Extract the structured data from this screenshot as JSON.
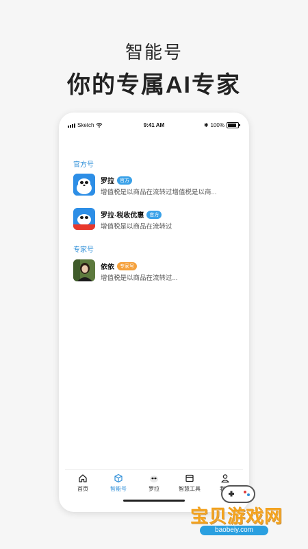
{
  "hero": {
    "title": "智能号",
    "subtitle": "你的专属AI专家"
  },
  "status_bar": {
    "carrier": "Sketch",
    "time": "9:41 AM",
    "battery": "100%"
  },
  "sections": {
    "official": "官方号",
    "experts": "专家号"
  },
  "accounts": [
    {
      "name": "罗拉",
      "badge": "官方",
      "desc": "增值税是以商品在流转过增值税是以商..."
    },
    {
      "name": "罗拉·税收优惠",
      "badge": "官方",
      "desc": "增值税是以商品在流转过"
    }
  ],
  "experts": [
    {
      "name": "依依",
      "badge": "专家号",
      "desc": "增值税是以商品在流转过..."
    }
  ],
  "tabbar": {
    "items": [
      {
        "label": "首页",
        "icon": "home-icon"
      },
      {
        "label": "智能号",
        "icon": "cube-icon"
      },
      {
        "label": "罗拉",
        "icon": "mascot-icon"
      },
      {
        "label": "智慧工具",
        "icon": "toolbox-icon"
      },
      {
        "label": "我的",
        "icon": "user-icon"
      }
    ],
    "active": "智能号"
  },
  "watermark": {
    "text": "宝贝游戏网",
    "url": "baobeiy.com"
  },
  "colors": {
    "accent": "#2f8fd8",
    "badge_blue": "#3aa1e8",
    "badge_orange": "#f5a13c"
  }
}
